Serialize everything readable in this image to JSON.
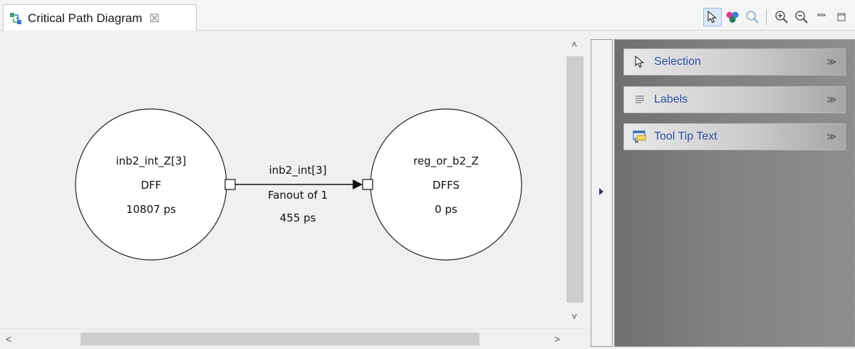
{
  "editor": {
    "tab_title": "Critical Path Diagram",
    "tab_close_glyph": "☒"
  },
  "toolbar": {
    "buttons": [
      {
        "name": "select-tool",
        "icon": "pointer-arrow-icon",
        "active": true
      },
      {
        "name": "color-tool",
        "icon": "color-balls-icon",
        "active": false
      },
      {
        "name": "find-tool",
        "icon": "magnifier-icon",
        "active": false
      },
      {
        "name": "zoom-in",
        "icon": "zoom-in-icon",
        "active": false
      },
      {
        "name": "zoom-out",
        "icon": "zoom-out-icon",
        "active": false
      },
      {
        "name": "minimize",
        "icon": "minimize-icon",
        "active": false
      },
      {
        "name": "maximize",
        "icon": "maximize-icon",
        "active": false
      }
    ]
  },
  "diagram": {
    "source_node": {
      "name": "inb2_int_Z[3]",
      "type": "DFF",
      "delay": "10807 ps"
    },
    "target_node": {
      "name": "reg_or_b2_Z",
      "type": "DFFS",
      "delay": "0 ps"
    },
    "edge": {
      "net": "inb2_int[3]",
      "fanout": "Fanout of 1",
      "delay": "455 ps"
    }
  },
  "scrollbars": {
    "up_glyph": "˄",
    "down_glyph": "˅",
    "left_glyph": "<",
    "right_glyph": ">"
  },
  "palette": {
    "drawers": [
      {
        "label": "Selection",
        "icon": "pointer-arrow-icon"
      },
      {
        "label": "Labels",
        "icon": "text-lines-icon"
      },
      {
        "label": "Tool Tip Text",
        "icon": "tooltip-icon"
      }
    ],
    "chevron_glyph": "≫"
  },
  "colors": {
    "accent_label": "#2d4fa3",
    "active_tool_bg": "#dbe8f8"
  }
}
